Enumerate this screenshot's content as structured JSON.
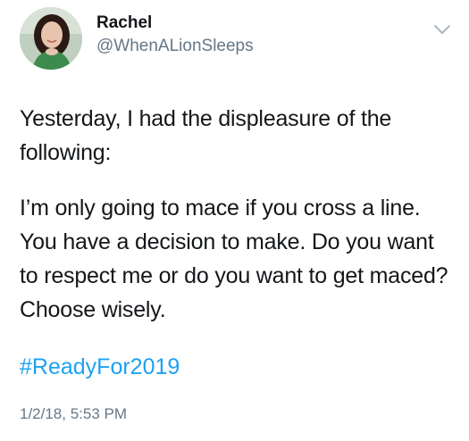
{
  "user": {
    "name": "Rachel",
    "handle": "@WhenALionSleeps"
  },
  "menu": {
    "icon": "chevron-down-icon"
  },
  "tweet": {
    "paragraph1": "Yesterday, I had the displeasure of the following:",
    "paragraph2": "I’m only going to mace if you cross a line. You have a decision to make. Do you want to respect me or do you want to get maced? Choose wisely.",
    "hashtag": "#ReadyFor2019",
    "timestamp": "1/2/18, 5:53 PM"
  },
  "colors": {
    "text": "#14171a",
    "secondary": "#657786",
    "link": "#1da1f2"
  }
}
